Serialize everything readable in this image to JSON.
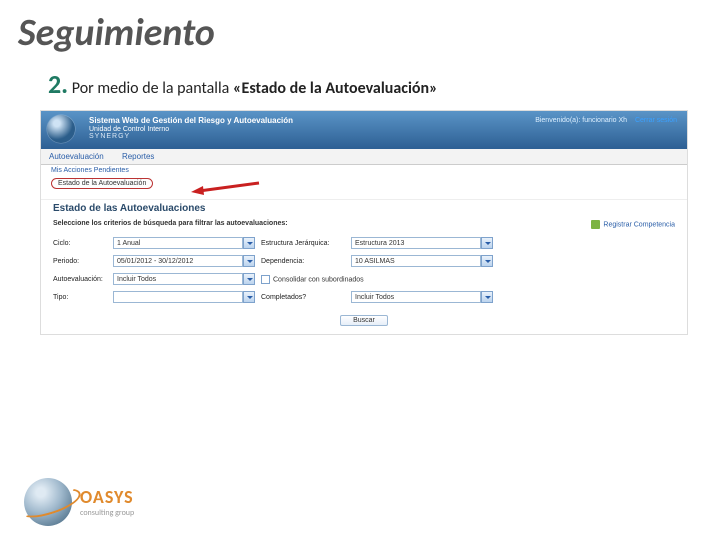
{
  "slide": {
    "title": "Seguimiento",
    "step_number": "2.",
    "step_prefix": "Por medio de la pantalla ",
    "step_bold": "«Estado de la Autoevaluación»"
  },
  "app": {
    "header": {
      "title_line1": "Sistema Web de Gestión del Riesgo y Autoevaluación",
      "title_line2": "Unidad de Control Interno",
      "brand": "SYNERGY",
      "welcome": "Bienvenido(a): funcionario Xh",
      "logout": "Cerrar sesión"
    },
    "menubar": {
      "item1": "Autoevaluación",
      "item2": "Reportes"
    },
    "submenu": {
      "line1": "Mis Acciones Pendientes",
      "highlight": "Estado de la Autoevaluación"
    },
    "page_heading": "Estado de las Autoevaluaciones",
    "criteria_text": "Seleccione los criterios de búsqueda para filtrar las autoevaluaciones:",
    "register_link": "Registrar Competencia",
    "filters": {
      "ciclo_label": "Ciclo:",
      "ciclo_value": "1   Anual",
      "estructura_label": "Estructura Jerárquica:",
      "estructura_value": "Estructura 2013",
      "periodo_label": "Periodo:",
      "periodo_value": "05/01/2012 - 30/12/2012",
      "dependencia_label": "Dependencia:",
      "dependencia_value": "10 ASILMAS",
      "autoeval_label": "Autoevaluación:",
      "autoeval_value": "Incluir Todos",
      "consolidar_label": "Consolidar con subordinados",
      "tipo_label": "Tipo:",
      "tipo_value": "",
      "completados_label": "Completados?",
      "completados_value": "Incluir Todos"
    },
    "buscar": "Buscar"
  },
  "footer": {
    "brand": "OASYS",
    "tagline": "consulting group"
  }
}
